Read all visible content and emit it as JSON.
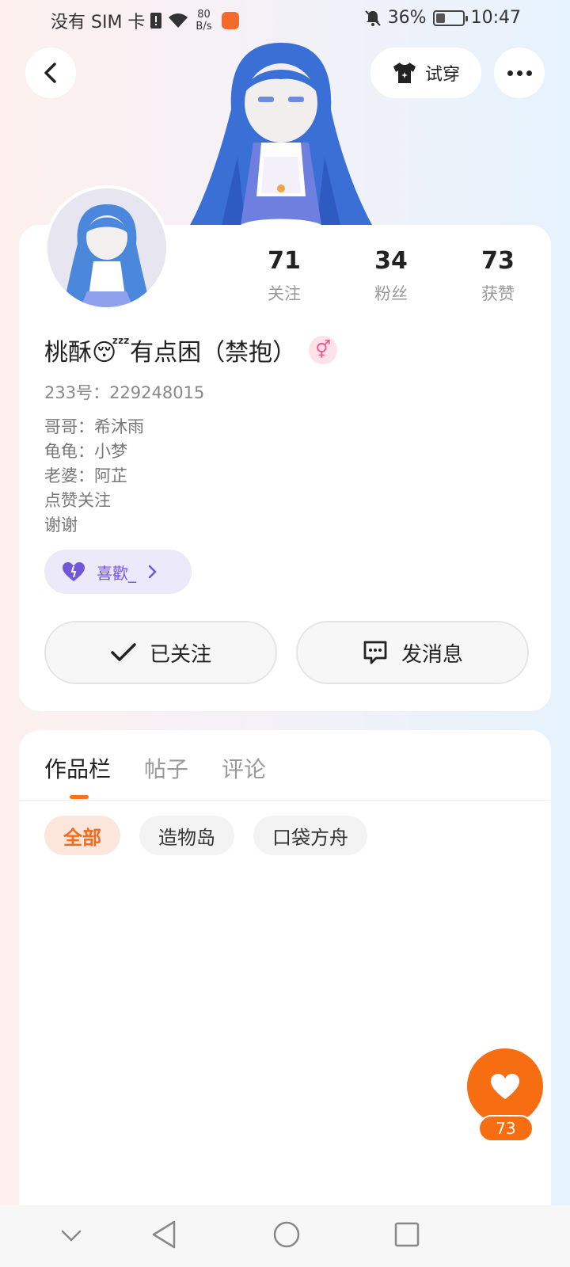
{
  "status_bar": {
    "carrier": "没有 SIM 卡",
    "net_speed_value": "80",
    "net_speed_unit": "B/s",
    "battery": "36%",
    "battery_level": 0.36,
    "time": "10:47"
  },
  "header": {
    "tryon_label": "试穿"
  },
  "profile": {
    "stats": [
      {
        "value": "71",
        "label": "关注"
      },
      {
        "value": "34",
        "label": "粉丝"
      },
      {
        "value": "73",
        "label": "获赞"
      }
    ],
    "name": "桃酥😴有点困（禁抱）",
    "gender_symbol": "⚥",
    "uid": "233号：229248015",
    "bio_lines": [
      "哥哥：希沐雨",
      "龟龟：小梦",
      "老婆：阿芷",
      "点赞关注",
      "谢谢"
    ],
    "like_tag": "喜歡_",
    "follow_label": "已关注",
    "message_label": "发消息"
  },
  "content": {
    "tabs": [
      "作品栏",
      "帖子",
      "评论"
    ],
    "filters": [
      "全部",
      "造物岛",
      "口袋方舟"
    ]
  },
  "fab": {
    "count": "73"
  },
  "colors": {
    "accent": "#f76d12",
    "purple": "#7058d8"
  }
}
